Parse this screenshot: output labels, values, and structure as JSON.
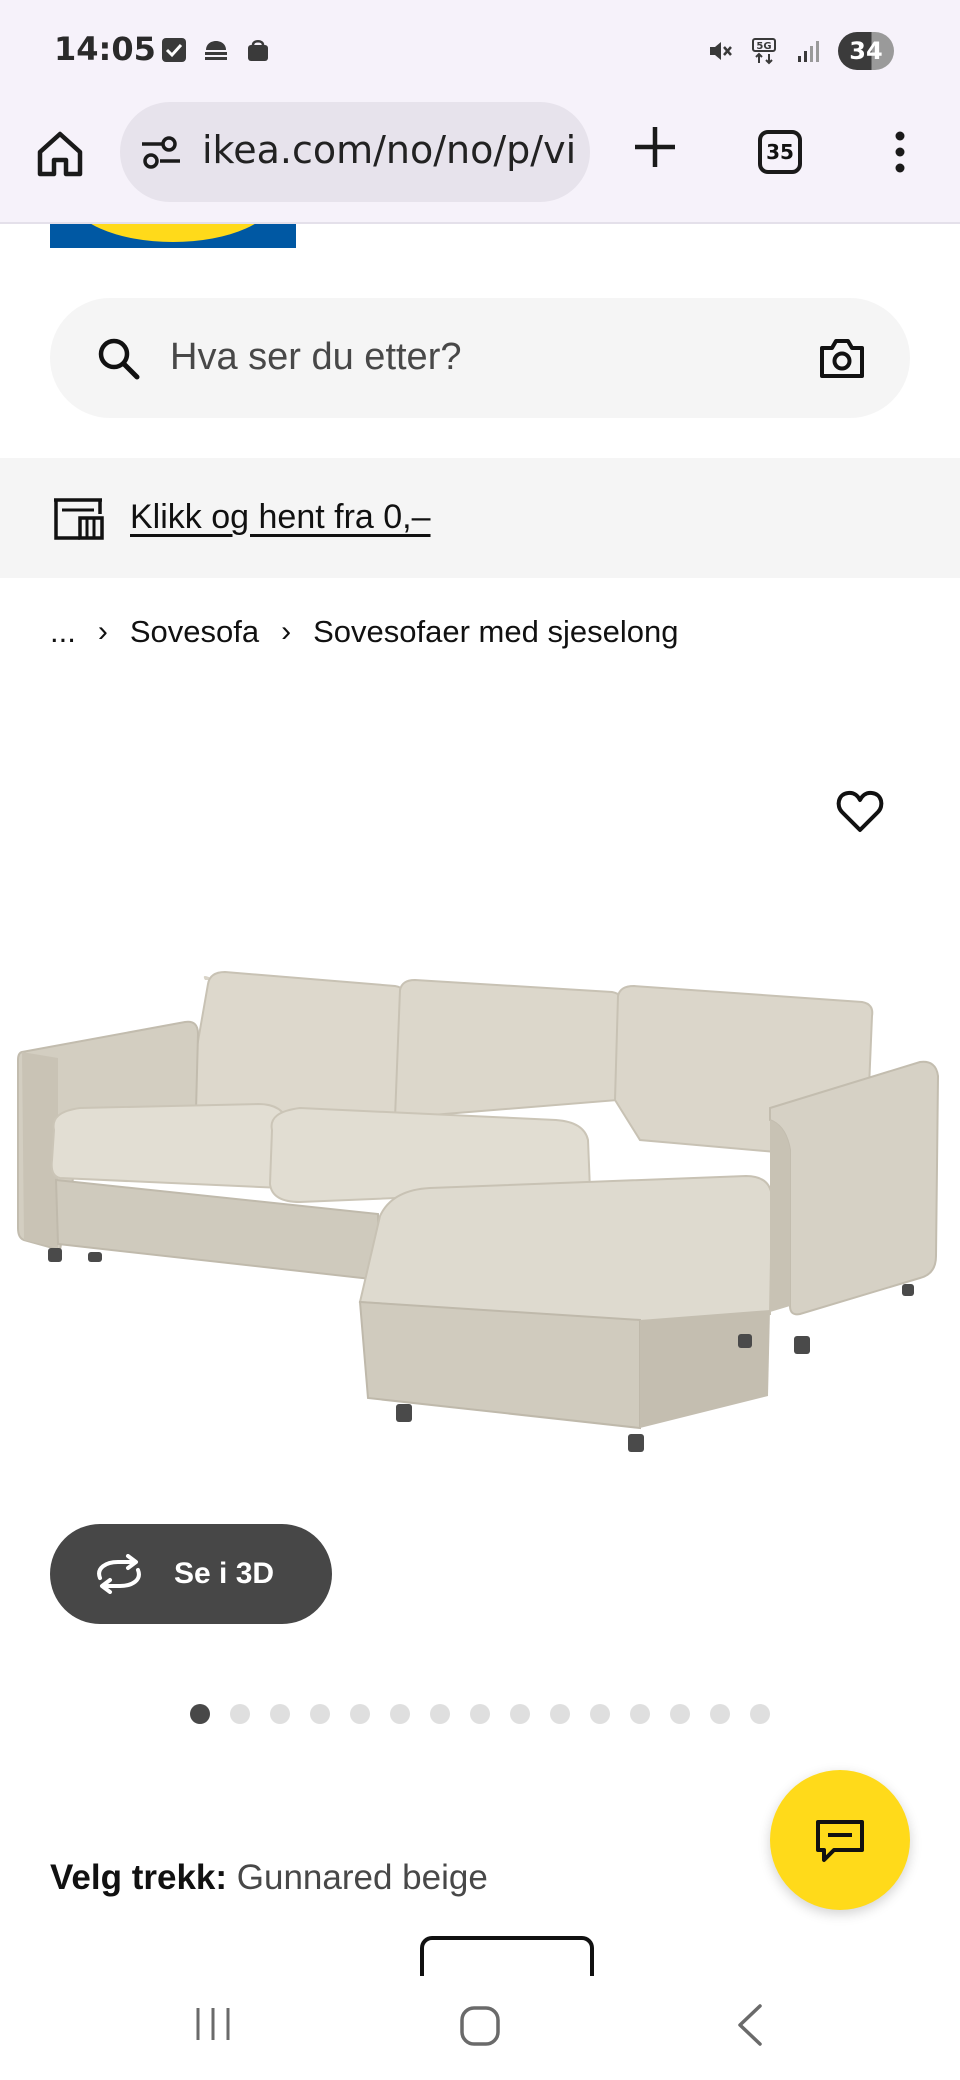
{
  "status_bar": {
    "time": "14:05",
    "battery": "34"
  },
  "browser": {
    "url": "ikea.com/no/no/p/vimle-sovesofa-med-sjeselong",
    "tab_count": "35"
  },
  "search": {
    "placeholder": "Hva ser du etter?"
  },
  "promo": {
    "text": "Klikk og hent fra 0,–"
  },
  "breadcrumb": {
    "ellipsis": "...",
    "items": [
      "Sovesofa",
      "Sovesofaer med sjeselong"
    ]
  },
  "product": {
    "view_3d_label": "Se i 3D",
    "carousel_count": 15,
    "carousel_active_index": 0,
    "cover_label": "Velg trekk:",
    "cover_value": "Gunnared beige"
  },
  "colors": {
    "ikea_blue": "#0058a3",
    "ikea_yellow": "#ffda1a",
    "button_dark": "#474747",
    "sofa_beige": "#d9d4c8"
  },
  "icons": {
    "status": [
      "checkbox-icon",
      "cloud-icon",
      "shopping-bag-icon",
      "mute-icon",
      "5g-icon",
      "signal-icon"
    ],
    "browser": [
      "home-icon",
      "site-settings-icon",
      "plus-icon",
      "tabs-icon",
      "more-vert-icon"
    ],
    "page": [
      "search-icon",
      "camera-icon",
      "store-icon",
      "heart-icon",
      "rotate-3d-icon",
      "chat-icon"
    ],
    "nav": [
      "recents-icon",
      "home-circle-icon",
      "back-icon"
    ]
  }
}
